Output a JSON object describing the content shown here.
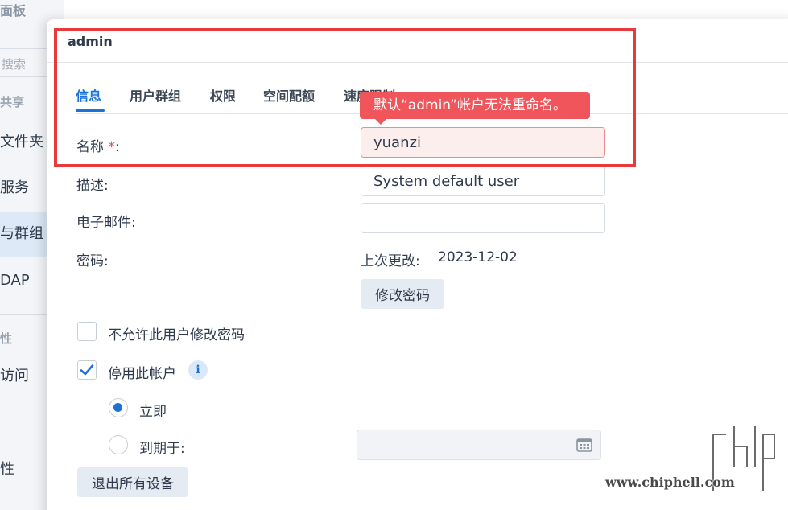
{
  "sidebar": {
    "header": "面板",
    "search_placeholder": "搜索",
    "section_share": "共享",
    "items": [
      "文件夹",
      "服务",
      "与群组",
      "DAP"
    ],
    "section_other": "性",
    "items2": [
      "访问",
      "性"
    ]
  },
  "dialog": {
    "title": "admin",
    "tabs": [
      "信息",
      "用户群组",
      "权限",
      "空间配额",
      "速度限制"
    ],
    "active_tab": "信息",
    "tooltip": "默认“admin”帐户无法重命名。",
    "name_label": "名称",
    "name_required": "*",
    "name_colon": ":",
    "name_value": "yuanzi",
    "desc_label": "描述:",
    "desc_value": "System default user",
    "email_label": "电子邮件:",
    "email_value": "",
    "password_label": "密码:",
    "last_changed_label": "上次更改:",
    "last_changed_value": "2023-12-02",
    "change_password_button": "修改密码",
    "disallow_change_label": "不允许此用户修改密码",
    "disable_account_label": "停用此帐户",
    "info_icon": "i",
    "radio_now_label": "立即",
    "radio_expire_label": "到期于:",
    "logout_all_button": "退出所有设备"
  },
  "watermark": {
    "text": "www.chiphell.com"
  },
  "colors": {
    "accent": "#1a73d9",
    "error": "#f0555b",
    "highlight_box": "#e83a3a"
  }
}
